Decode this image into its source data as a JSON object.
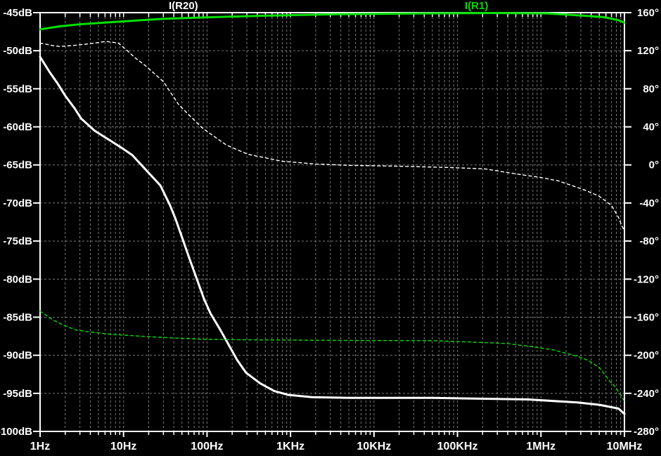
{
  "page": {
    "background": "#000000"
  },
  "legend": {
    "ir20_label": "I(R20)",
    "ir1_label": "I(R1)"
  },
  "chart_data": {
    "type": "line",
    "x_axis": {
      "scale": "log",
      "min_hz": 1,
      "max_hz": 10000000,
      "tick_labels": [
        "1Hz",
        "10Hz",
        "100Hz",
        "1KHz",
        "10KHz",
        "100KHz",
        "1MHz",
        "10MHz"
      ],
      "tick_freqs": [
        1,
        10,
        100,
        1000,
        10000,
        100000,
        1000000,
        10000000
      ]
    },
    "left_axis": {
      "unit": "dB",
      "max": -45,
      "min": -100,
      "step": 5,
      "tick_labels": [
        "-45dB",
        "-50dB",
        "-55dB",
        "-60dB",
        "-65dB",
        "-70dB",
        "-75dB",
        "-80dB",
        "-85dB",
        "-90dB",
        "-95dB",
        "-100dB"
      ],
      "tick_values": [
        -45,
        -50,
        -55,
        -60,
        -65,
        -70,
        -75,
        -80,
        -85,
        -90,
        -95,
        -100
      ]
    },
    "right_axis": {
      "unit": "degrees",
      "max": 160,
      "min": -280,
      "step": 40,
      "tick_labels": [
        "160°",
        "120°",
        "80°",
        "40°",
        "0°",
        "-40°",
        "-80°",
        "-120°",
        "-160°",
        "-200°",
        "-240°",
        "-280°"
      ],
      "tick_values": [
        160,
        120,
        80,
        40,
        0,
        -40,
        -80,
        -120,
        -160,
        -200,
        -240,
        -280
      ]
    },
    "grid": {
      "on": true,
      "color": "#7a7a7a",
      "frame_color": "#ffffff"
    },
    "series": [
      {
        "name": "I(R20) magnitude",
        "color": "#ffffff",
        "style": "solid",
        "axis": "left",
        "width": 3,
        "points": [
          [
            1,
            -50.8
          ],
          [
            1.3,
            -52.8
          ],
          [
            1.6,
            -54.2
          ],
          [
            2,
            -55.9
          ],
          [
            2.6,
            -57.6
          ],
          [
            3.1,
            -58.9
          ],
          [
            4.5,
            -60.5
          ],
          [
            6.7,
            -61.7
          ],
          [
            9.3,
            -62.7
          ],
          [
            12.7,
            -63.7
          ],
          [
            18.7,
            -65.7
          ],
          [
            27.6,
            -67.7
          ],
          [
            36,
            -70.3
          ],
          [
            42,
            -72.1
          ],
          [
            62,
            -77.4
          ],
          [
            92,
            -82.6
          ],
          [
            110,
            -84.5
          ],
          [
            143,
            -86.6
          ],
          [
            165,
            -87.8
          ],
          [
            229,
            -90.6
          ],
          [
            294,
            -92.3
          ],
          [
            434,
            -93.7
          ],
          [
            639,
            -94.7
          ],
          [
            941,
            -95.2
          ],
          [
            1800,
            -95.5
          ],
          [
            5000,
            -95.6
          ],
          [
            50000,
            -95.6
          ],
          [
            700000,
            -95.8
          ],
          [
            2700000,
            -96.2
          ],
          [
            5000000,
            -96.5
          ],
          [
            8500000,
            -97.0
          ],
          [
            10000000,
            -97.7
          ]
        ]
      },
      {
        "name": "I(R20) phase",
        "color": "#ffffff",
        "style": "dashed",
        "axis": "right",
        "width": 1.4,
        "points": [
          [
            1,
            128
          ],
          [
            1.4,
            125.5
          ],
          [
            1.7,
            124.5
          ],
          [
            2.5,
            125.5
          ],
          [
            3.4,
            126.7
          ],
          [
            4.5,
            128
          ],
          [
            6.1,
            129.7
          ],
          [
            8.6,
            128.2
          ],
          [
            10.5,
            122
          ],
          [
            13.7,
            112.7
          ],
          [
            17.7,
            105.3
          ],
          [
            30,
            87.5
          ],
          [
            46,
            63
          ],
          [
            88,
            38.7
          ],
          [
            170,
            21
          ],
          [
            305,
            11.3
          ],
          [
            780,
            3.9
          ],
          [
            2000,
            1
          ],
          [
            5400,
            -0.5
          ],
          [
            17000,
            -1.2
          ],
          [
            80000,
            -2.7
          ],
          [
            215000,
            -4.2
          ],
          [
            443000,
            -8.6
          ],
          [
            642000,
            -10.8
          ],
          [
            966000,
            -13
          ],
          [
            1600000,
            -16.7
          ],
          [
            2400000,
            -21.9
          ],
          [
            3500000,
            -27.1
          ],
          [
            5000000,
            -33
          ],
          [
            7000000,
            -42.6
          ],
          [
            8500000,
            -55.2
          ],
          [
            9400000,
            -64.8
          ],
          [
            10000000,
            -69
          ]
        ]
      },
      {
        "name": "I(R1) magnitude",
        "color": "#00e000",
        "style": "solid",
        "axis": "left",
        "width": 3,
        "points": [
          [
            1,
            -47.2
          ],
          [
            1.7,
            -46.8
          ],
          [
            3.2,
            -46.5
          ],
          [
            8.4,
            -46.2
          ],
          [
            30,
            -45.8
          ],
          [
            110,
            -45.6
          ],
          [
            525,
            -45.4
          ],
          [
            3700,
            -45.2
          ],
          [
            38000,
            -45.1
          ],
          [
            260000,
            -45.05
          ],
          [
            1200000,
            -45.1
          ],
          [
            3200000,
            -45.4
          ],
          [
            5800000,
            -45.6
          ],
          [
            8500000,
            -46.0
          ],
          [
            10000000,
            -46.3
          ]
        ]
      },
      {
        "name": "I(R1) phase",
        "color": "#00e000",
        "style": "dashed",
        "axis": "right",
        "width": 1.4,
        "points": [
          [
            1,
            -153.6
          ],
          [
            1.4,
            -162.4
          ],
          [
            1.9,
            -168.4
          ],
          [
            2.7,
            -173.5
          ],
          [
            4.3,
            -175.8
          ],
          [
            7.1,
            -178
          ],
          [
            17.7,
            -180.2
          ],
          [
            36,
            -181.7
          ],
          [
            88,
            -183.2
          ],
          [
            450,
            -183.9
          ],
          [
            5400,
            -184.5
          ],
          [
            55000,
            -184.7
          ],
          [
            385000,
            -187.6
          ],
          [
            730000,
            -190.6
          ],
          [
            1400000,
            -194.3
          ],
          [
            2700000,
            -200.9
          ],
          [
            3700000,
            -205.4
          ],
          [
            5000000,
            -212.8
          ],
          [
            6600000,
            -226.8
          ],
          [
            7700000,
            -232.7
          ],
          [
            8500000,
            -238.6
          ],
          [
            9400000,
            -243.8
          ],
          [
            10000000,
            -249
          ]
        ]
      }
    ]
  }
}
